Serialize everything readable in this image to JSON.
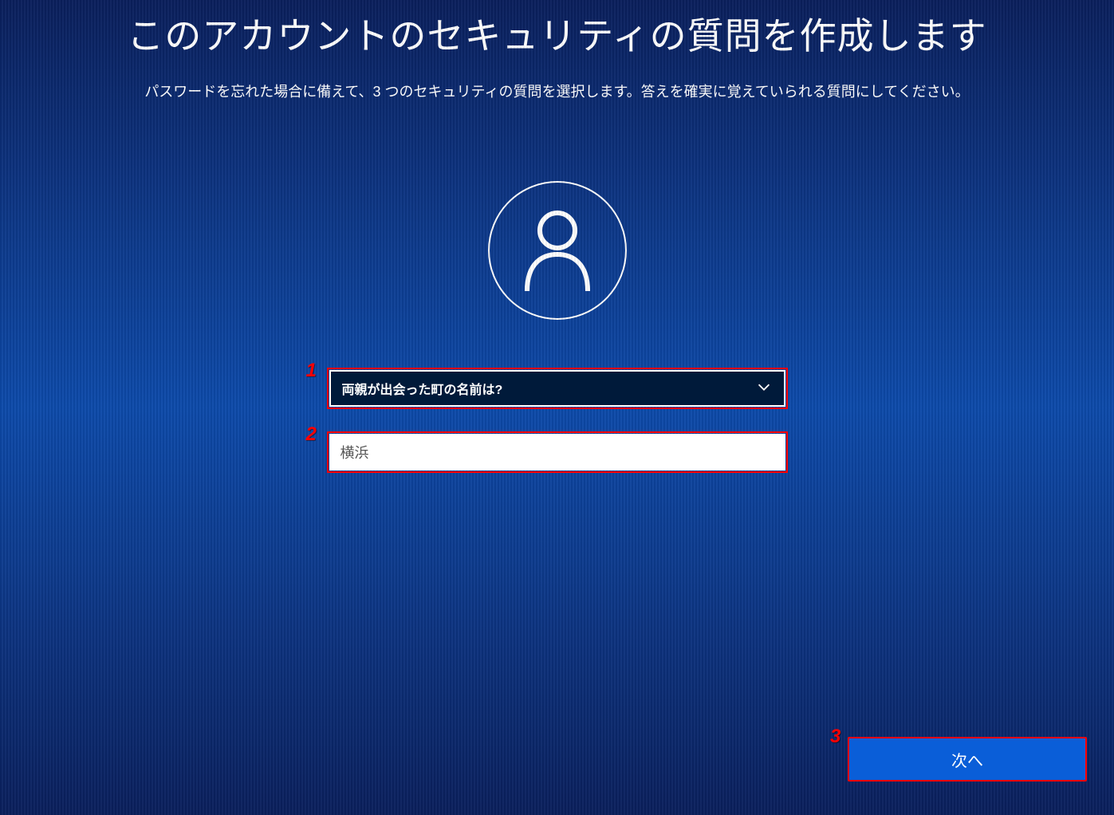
{
  "title": "このアカウントのセキュリティの質問を作成します",
  "subtitle": "パスワードを忘れた場合に備えて、3 つのセキュリティの質問を選択します。答えを確実に覚えていられる質問にしてください。",
  "annotations": {
    "q_select": "1",
    "answer": "2",
    "next": "3"
  },
  "form": {
    "question_select": {
      "selected": "両親が出会った町の名前は?"
    },
    "answer": {
      "value": "横浜"
    }
  },
  "buttons": {
    "next": "次へ"
  },
  "colors": {
    "annotation": "#ff0000",
    "background": "#0d3a8c",
    "select_bg": "#001a3a",
    "next_bg": "#0a5ed8"
  }
}
